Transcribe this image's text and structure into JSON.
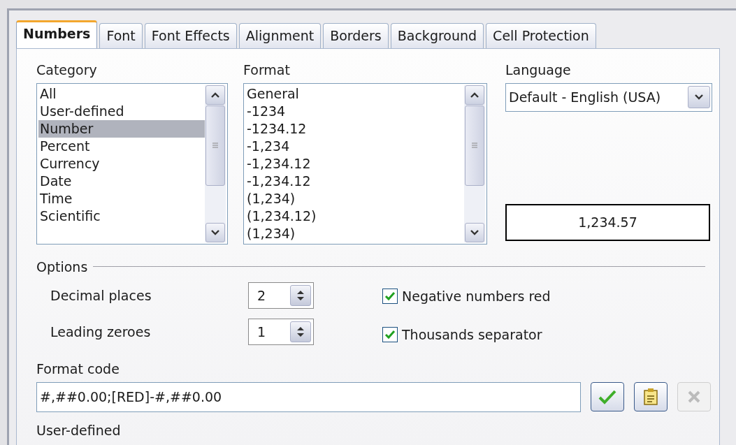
{
  "tabs": [
    {
      "label": "Numbers",
      "selected": true
    },
    {
      "label": "Font",
      "selected": false
    },
    {
      "label": "Font Effects",
      "selected": false
    },
    {
      "label": "Alignment",
      "selected": false
    },
    {
      "label": "Borders",
      "selected": false
    },
    {
      "label": "Background",
      "selected": false
    },
    {
      "label": "Cell Protection",
      "selected": false
    }
  ],
  "category": {
    "label": "Category",
    "items": [
      {
        "label": "All",
        "selected": false
      },
      {
        "label": "User-defined",
        "selected": false
      },
      {
        "label": "Number",
        "selected": true
      },
      {
        "label": "Percent",
        "selected": false
      },
      {
        "label": "Currency",
        "selected": false
      },
      {
        "label": "Date",
        "selected": false
      },
      {
        "label": "Time",
        "selected": false
      },
      {
        "label": "Scientific",
        "selected": false
      }
    ]
  },
  "format": {
    "label": "Format",
    "items": [
      {
        "label": "General",
        "selected": false
      },
      {
        "label": "-1234",
        "selected": false
      },
      {
        "label": "-1234.12",
        "selected": false
      },
      {
        "label": "-1,234",
        "selected": false
      },
      {
        "label": "-1,234.12",
        "selected": false
      },
      {
        "label": "-1,234.12",
        "selected": false
      },
      {
        "label": "(1,234)",
        "selected": false
      },
      {
        "label": "(1,234.12)",
        "selected": false
      },
      {
        "label": "(1,234)",
        "selected": false
      }
    ]
  },
  "language": {
    "label": "Language",
    "value": "Default - English (USA)"
  },
  "preview": "1,234.57",
  "options": {
    "title": "Options",
    "spinners": [
      {
        "label": "Decimal places",
        "value": "2"
      },
      {
        "label": "Leading zeroes",
        "value": "1"
      }
    ],
    "checkboxes": [
      {
        "label": "Negative numbers red",
        "checked": true
      },
      {
        "label": "Thousands separator",
        "checked": true
      }
    ]
  },
  "format_code": {
    "label": "Format code",
    "value": "#,##0.00;[RED]-#,##0.00",
    "buttons": [
      {
        "kind": "accept",
        "disabled": false
      },
      {
        "kind": "comment",
        "disabled": false
      },
      {
        "kind": "delete",
        "disabled": true
      }
    ]
  },
  "status": "User-defined"
}
